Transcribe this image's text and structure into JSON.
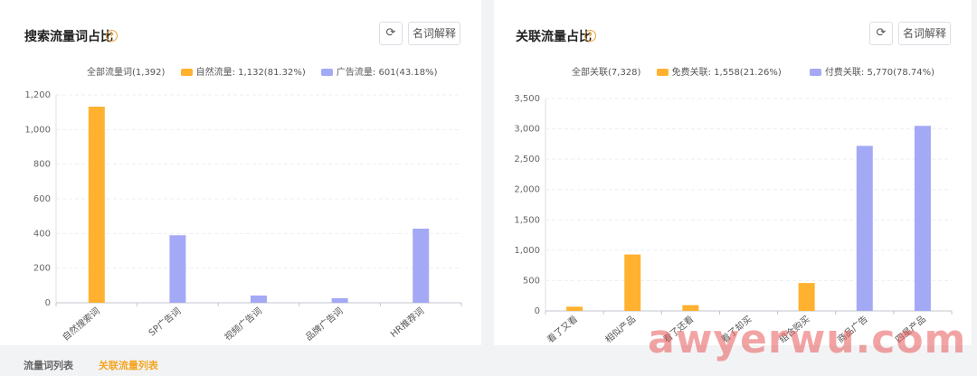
{
  "colors": {
    "natural": "#ffb12f",
    "paid": "#a4a9f5",
    "accent": "#f5a623",
    "icon": "#e6a23c"
  },
  "icons": {
    "help": "question-circle-icon",
    "refresh": "refresh-icon"
  },
  "panels": [
    {
      "title": "搜索流量词占比",
      "help_glyph": "?",
      "refresh_glyph": "⟳",
      "term_button": "名词解释",
      "legend": {
        "total": "全部流量词(1,392)",
        "items": [
          "自然流量: 1,132(81.32%)",
          "广告流量: 601(43.18%)"
        ]
      }
    },
    {
      "title": "关联流量占比",
      "help_glyph": "?",
      "refresh_glyph": "⟳",
      "term_button": "名词解释",
      "legend": {
        "total": "全部关联(7,328)",
        "items": [
          "免费关联: 1,558(21.26%)",
          "付费关联: 5,770(78.74%)"
        ]
      }
    }
  ],
  "chart_data": [
    {
      "type": "bar",
      "categories": [
        "自然搜索词",
        "SP广告词",
        "视频广告词",
        "品牌广告词",
        "HR推荐词"
      ],
      "series": [
        {
          "name": "自然流量",
          "values": [
            1132,
            0,
            0,
            0,
            0
          ]
        },
        {
          "name": "广告流量",
          "values": [
            0,
            390,
            42,
            27,
            428
          ]
        }
      ],
      "ylim": [
        0,
        1200
      ],
      "yticks": [
        "0",
        "200",
        "400",
        "600",
        "800",
        "1,000",
        "1,200"
      ],
      "legend_position": "top",
      "grid": true
    },
    {
      "type": "bar",
      "categories": [
        "看了又看",
        "相似产品",
        "看了还看",
        "看了却买",
        "组合购买",
        "商品广告",
        "四星产品"
      ],
      "series": [
        {
          "name": "免费关联",
          "values": [
            70,
            930,
            95,
            0,
            460,
            0,
            0
          ]
        },
        {
          "name": "付费关联",
          "values": [
            0,
            0,
            0,
            0,
            0,
            2720,
            3050
          ]
        }
      ],
      "ylim": [
        0,
        3500
      ],
      "yticks": [
        "0",
        "500",
        "1,000",
        "1,500",
        "2,000",
        "2,500",
        "3,000",
        "3,500"
      ],
      "legend_position": "top",
      "grid": true
    }
  ],
  "tabs": [
    "流量词列表",
    "关联流量列表"
  ],
  "active_tab": 1,
  "watermark": "awyerwu.com"
}
